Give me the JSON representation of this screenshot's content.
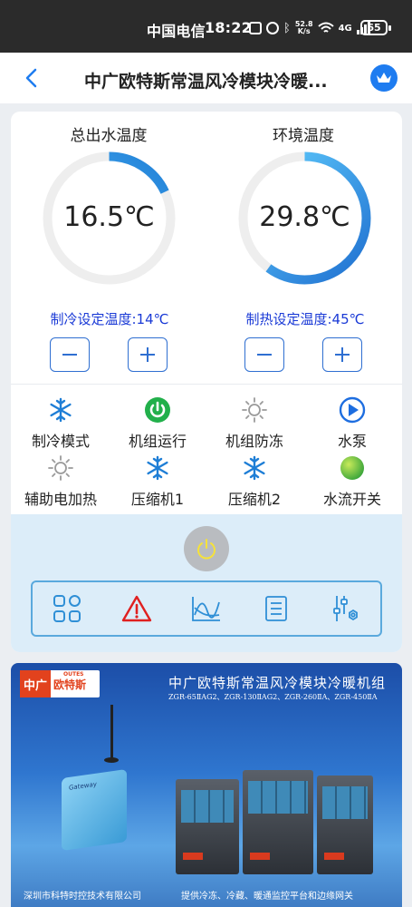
{
  "status_bar": {
    "carrier": "中国电信",
    "time": "18:22",
    "speed_value": "52.8",
    "speed_unit": "K/s",
    "network": "4G",
    "battery": "65"
  },
  "nav": {
    "title": "中广欧特斯常温风冷模块冷暖...",
    "back_icon": "chevron-left-icon",
    "crown_icon": "crown-icon"
  },
  "gauges": {
    "outlet": {
      "label": "总出水温度",
      "value": "16.5℃",
      "fill_fraction": 0.18,
      "color_start": "#62c8ff",
      "color_end": "#1e7ed6"
    },
    "ambient": {
      "label": "环境温度",
      "value": "29.8℃",
      "fill_fraction": 0.6,
      "color_start": "#62d0ff",
      "color_end": "#1f6fd0"
    },
    "track_color": "#eeeeee"
  },
  "setpoints": {
    "cooling": {
      "label": "制冷设定温度:14℃",
      "minus": "−",
      "plus": "+"
    },
    "heating": {
      "label": "制热设定温度:45℃",
      "minus": "−",
      "plus": "+"
    }
  },
  "status_items": [
    {
      "label": "制冷模式",
      "icon": "snowflake-icon",
      "color": "#1e7ed6"
    },
    {
      "label": "机组运行",
      "icon": "power-on-icon",
      "color": "#22b04b"
    },
    {
      "label": "机组防冻",
      "icon": "sun-icon",
      "color": "#9a9a9a"
    },
    {
      "label": "水泵",
      "icon": "play-icon",
      "color": "#1e6ee0"
    },
    {
      "label": "辅助电加热",
      "icon": "sun-icon",
      "color": "#9a9a9a"
    },
    {
      "label": "压缩机1",
      "icon": "snowflake-icon",
      "color": "#1e7ed6"
    },
    {
      "label": "压缩机2",
      "icon": "snowflake-icon",
      "color": "#1e7ed6"
    },
    {
      "label": "水流开关",
      "icon": "green-dot-icon",
      "color": "#7bc536"
    }
  ],
  "controls": {
    "power_icon": "power-icon",
    "toolbar": [
      "grid-icon",
      "alarm-icon",
      "chart-icon",
      "list-icon",
      "settings-icon"
    ]
  },
  "banner": {
    "logo_cn": "中广",
    "logo_brand": "欧特斯",
    "logo_en": "OUTES",
    "title": "中广欧特斯常温风冷模块冷暖机组",
    "models": "ZGR-65ⅡAG2、ZGR-130ⅡAG2、ZGR-260ⅡA、ZGR-450ⅡA",
    "device_label": "Gateway",
    "footer_left": "深圳市科特时控技术有限公司",
    "footer_right": "提供冷冻、冷藏、暖通监控平台和边缘网关"
  }
}
